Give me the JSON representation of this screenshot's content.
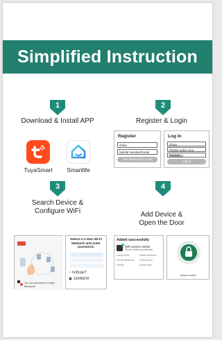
{
  "banner": {
    "title": "Simplified Instruction"
  },
  "steps": [
    {
      "number": "1",
      "title": "Download & Install APP"
    },
    {
      "number": "2",
      "title": "Register & Login"
    },
    {
      "number": "3",
      "title_line1": "Search Device &",
      "title_line2": "Configure WiFi"
    },
    {
      "number": "4",
      "title_line1": "Add Device &",
      "title_line2": "Open the Door"
    }
  ],
  "apps": [
    {
      "name": "TuyaSmart",
      "icon": "tuya-icon",
      "color": "#ff4a1c"
    },
    {
      "name": "Smartlife",
      "icon": "smartlife-house-icon",
      "color": "#3aa7e6"
    }
  ],
  "register_panel": {
    "title": "Register",
    "field1": "china",
    "field2": "Mobile Number/Email",
    "button": "Get Verification Code"
  },
  "login_panel": {
    "title": "Log In",
    "field1": "china",
    "field2": "Please enter your account",
    "field3": "Password",
    "button": "Log In"
  },
  "wifi_panel": {
    "title_line1": "Select 2.4 GHz Wi-Fi",
    "title_line2": "Network and enter",
    "title_line3": "password.",
    "network": "hr39.jia/T",
    "password": "12345678",
    "bluetooth_note": "You are advised to enable Bluetooth"
  },
  "added_panel": {
    "title": "Added successfully",
    "device": "WiFi access control",
    "device_sub": "Device added successfully",
    "rooms": [
      "Living Room",
      "Master Bedroom",
      "Second Bedroom",
      "Dining Room",
      "Kitchen",
      "Study Room"
    ]
  },
  "door_panel": {
    "label": "Access control"
  },
  "colors": {
    "accent": "#1f8b79",
    "banner": "#237f6e"
  }
}
